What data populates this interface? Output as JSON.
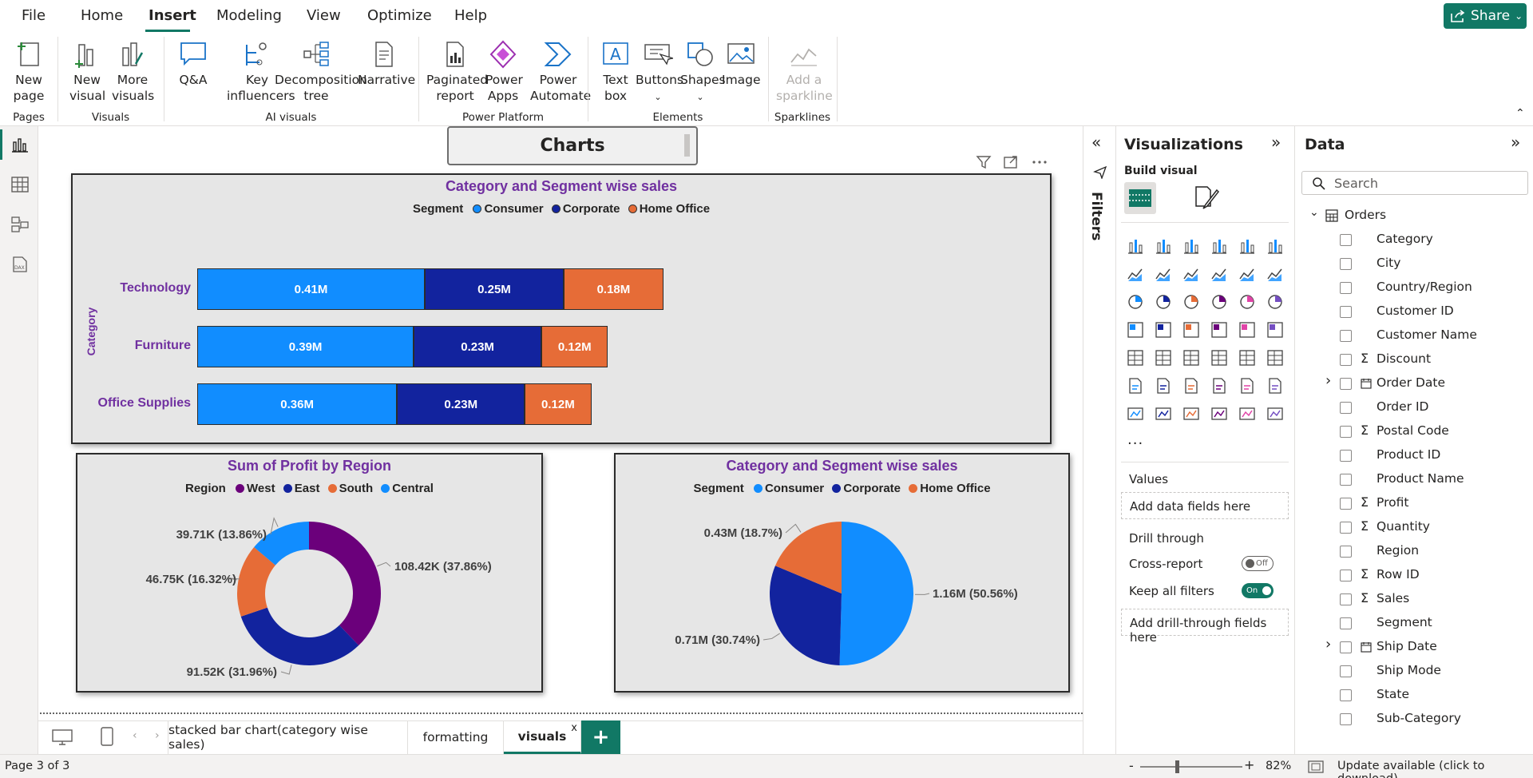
{
  "menu": {
    "items": [
      "File",
      "Home",
      "Insert",
      "Modeling",
      "View",
      "Optimize",
      "Help"
    ],
    "active": "Insert",
    "share_label": "Share"
  },
  "ribbon": {
    "new_page": "New page",
    "new_visual": "New visual",
    "more_visuals": "More visuals",
    "qna": "Q&A",
    "key_influencers": "Key influencers",
    "decomposition_tree": "Decomposition tree",
    "narrative": "Narrative",
    "paginated_report": "Paginated report",
    "power_apps": "Power Apps",
    "power_automate": "Power Automate",
    "text_box": "Text box",
    "buttons": "Buttons",
    "shapes": "Shapes",
    "image": "Image",
    "add_sparkline": "Add a sparkline",
    "groups": {
      "pages": "Pages",
      "visuals": "Visuals",
      "ai_visuals": "AI visuals",
      "power_platform": "Power Platform",
      "elements": "Elements",
      "sparklines": "Sparklines"
    }
  },
  "canvas": {
    "title": "Charts"
  },
  "chart_data": [
    {
      "type": "bar",
      "orientation": "horizontal-stacked",
      "title": "Category and Segment wise sales",
      "legend_title": "Segment",
      "legend_position": "top",
      "ylabel": "Category",
      "categories": [
        "Technology",
        "Furniture",
        "Office Supplies"
      ],
      "series": [
        {
          "name": "Consumer",
          "values": [
            0.41,
            0.39,
            0.36
          ],
          "labels": [
            "0.41M",
            "0.39M",
            "0.36M"
          ]
        },
        {
          "name": "Corporate",
          "values": [
            0.25,
            0.23,
            0.23
          ],
          "labels": [
            "0.25M",
            "0.23M",
            "0.23M"
          ]
        },
        {
          "name": "Home Office",
          "values": [
            0.18,
            0.12,
            0.12
          ],
          "labels": [
            "0.18M",
            "0.12M",
            "0.12M"
          ]
        }
      ],
      "unit": "M",
      "colors": {
        "Consumer": "#118dff",
        "Corporate": "#12239e",
        "Home Office": "#e66c37"
      }
    },
    {
      "type": "pie",
      "variant": "donut",
      "title": "Sum of Profit by Region",
      "legend_title": "Region",
      "legend_position": "top",
      "categories": [
        "West",
        "East",
        "South",
        "Central"
      ],
      "values": [
        108.42,
        91.52,
        46.75,
        39.71
      ],
      "labels": [
        "108.42K (37.86%)",
        "91.52K (31.96%)",
        "46.75K (16.32%)",
        "39.71K (13.86%)"
      ],
      "unit": "K",
      "colors": {
        "West": "#6b007b",
        "East": "#12239e",
        "South": "#e66c37",
        "Central": "#118dff"
      }
    },
    {
      "type": "pie",
      "title": "Category and Segment wise sales",
      "legend_title": "Segment",
      "legend_position": "top",
      "categories": [
        "Consumer",
        "Corporate",
        "Home Office"
      ],
      "values": [
        1.16,
        0.71,
        0.43
      ],
      "labels": [
        "1.16M (50.56%)",
        "0.71M (30.74%)",
        "0.43M (18.7%)"
      ],
      "unit": "M",
      "colors": {
        "Consumer": "#118dff",
        "Corporate": "#12239e",
        "Home Office": "#e66c37"
      }
    }
  ],
  "filters_pane": {
    "label": "Filters"
  },
  "visualizations": {
    "title": "Visualizations",
    "build_visual": "Build visual",
    "values_label": "Values",
    "values_placeholder": "Add data fields here",
    "drill_through": "Drill through",
    "cross_report": "Cross-report",
    "cross_report_state": "Off",
    "keep_all_filters": "Keep all filters",
    "keep_all_filters_state": "On",
    "drill_placeholder": "Add drill-through fields here",
    "more": "..."
  },
  "data_pane": {
    "title": "Data",
    "search_placeholder": "Search",
    "table": "Orders",
    "fields": [
      {
        "name": "Category",
        "sigma": false,
        "expandable": false
      },
      {
        "name": "City",
        "sigma": false,
        "expandable": false
      },
      {
        "name": "Country/Region",
        "sigma": false,
        "expandable": false
      },
      {
        "name": "Customer ID",
        "sigma": false,
        "expandable": false
      },
      {
        "name": "Customer Name",
        "sigma": false,
        "expandable": false
      },
      {
        "name": "Discount",
        "sigma": true,
        "expandable": false
      },
      {
        "name": "Order Date",
        "sigma": false,
        "expandable": true,
        "calendar": true
      },
      {
        "name": "Order ID",
        "sigma": false,
        "expandable": false
      },
      {
        "name": "Postal Code",
        "sigma": true,
        "expandable": false
      },
      {
        "name": "Product ID",
        "sigma": false,
        "expandable": false
      },
      {
        "name": "Product Name",
        "sigma": false,
        "expandable": false
      },
      {
        "name": "Profit",
        "sigma": true,
        "expandable": false
      },
      {
        "name": "Quantity",
        "sigma": true,
        "expandable": false
      },
      {
        "name": "Region",
        "sigma": false,
        "expandable": false
      },
      {
        "name": "Row ID",
        "sigma": true,
        "expandable": false
      },
      {
        "name": "Sales",
        "sigma": true,
        "expandable": false
      },
      {
        "name": "Segment",
        "sigma": false,
        "expandable": false
      },
      {
        "name": "Ship Date",
        "sigma": false,
        "expandable": true,
        "calendar": true
      },
      {
        "name": "Ship Mode",
        "sigma": false,
        "expandable": false
      },
      {
        "name": "State",
        "sigma": false,
        "expandable": false
      },
      {
        "name": "Sub-Category",
        "sigma": false,
        "expandable": false
      }
    ]
  },
  "tabs": {
    "items": [
      "stacked bar chart(category wise sales)",
      "formatting",
      "visuals"
    ],
    "active": "visuals",
    "close": "x",
    "add": "+"
  },
  "status": {
    "page": "Page 3 of 3",
    "zoom": "82%",
    "zoom_minus": "-",
    "zoom_plus": "+",
    "update": "Update available (click to download)"
  }
}
